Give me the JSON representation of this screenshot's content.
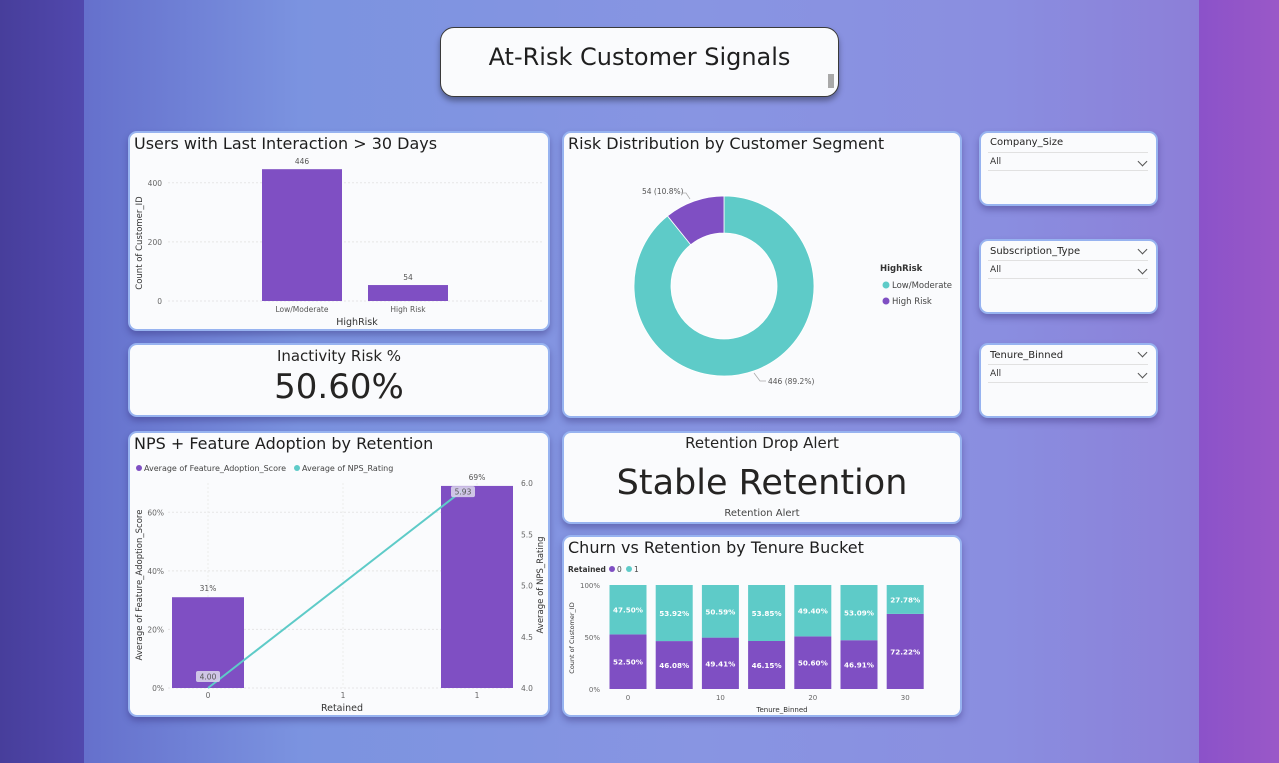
{
  "page": {
    "title": "At-Risk Customer Signals"
  },
  "colors": {
    "purple": "#7f4fc3",
    "teal": "#5ecbc8",
    "card_border": "#97b3f0"
  },
  "users_chart": {
    "title": "Users with Last Interaction > 30 Days",
    "ylabel": "Count of Customer_ID",
    "xlabel": "HighRisk",
    "yticks": [
      "0",
      "200",
      "400"
    ]
  },
  "inactivity": {
    "label": "Inactivity Risk %",
    "value": "50.60%"
  },
  "risk_dist": {
    "title": "Risk Distribution by Customer Segment",
    "legend_title": "HighRisk",
    "label_high": "54 (10.8%)",
    "label_low": "446 (89.2%)"
  },
  "retention_alert": {
    "title": "Retention Drop Alert",
    "value": "Stable Retention",
    "caption": "Retention Alert"
  },
  "nps_chart": {
    "title": "NPS + Feature Adoption by Retention",
    "legend": [
      "Average of Feature_Adoption_Score",
      "Average of NPS_Rating"
    ],
    "ylabel_left": "Average of Feature_Adoption_Score",
    "ylabel_right": "Average of NPS_Rating",
    "xlabel": "Retained",
    "left_ticks": [
      "0%",
      "20%",
      "40%",
      "60%"
    ],
    "right_ticks": [
      "4.0",
      "4.5",
      "5.0",
      "5.5",
      "6.0"
    ],
    "x_ticks": [
      "0",
      "1",
      "1"
    ]
  },
  "churn_chart": {
    "title": "Churn vs Retention by Tenure Bucket",
    "legend_title": "Retained",
    "legend": [
      "0",
      "1"
    ],
    "ylabel": "Count of Customer_ID",
    "xlabel": "Tenure_Binned",
    "yticks": [
      "0%",
      "50%",
      "100%"
    ],
    "xticks": [
      "0",
      "10",
      "20",
      "30",
      "40"
    ]
  },
  "slicers": [
    {
      "label": "Company_Size",
      "value": "All"
    },
    {
      "label": "Subscription_Type",
      "value": "All"
    },
    {
      "label": "Tenure_Binned",
      "value": "All"
    }
  ],
  "chart_data": [
    {
      "type": "bar",
      "title": "Users with Last Interaction > 30 Days",
      "categories": [
        "Low/Moderate",
        "High Risk"
      ],
      "values": [
        446,
        54
      ],
      "xlabel": "HighRisk",
      "ylabel": "Count of Customer_ID",
      "ylim": [
        0,
        450
      ]
    },
    {
      "type": "pie",
      "title": "Risk Distribution by Customer Segment",
      "categories": [
        "Low/Moderate",
        "High Risk"
      ],
      "values": [
        446,
        54
      ],
      "percentages": [
        89.2,
        10.8
      ],
      "legend_title": "HighRisk",
      "legend": "right"
    },
    {
      "type": "bar",
      "title": "NPS + Feature Adoption by Retention",
      "categories": [
        "0",
        "1"
      ],
      "series": [
        {
          "name": "Average of Feature_Adoption_Score",
          "values": [
            31,
            69
          ],
          "labels": [
            "31%",
            "69%"
          ]
        },
        {
          "name": "Average of NPS_Rating",
          "values": [
            4.0,
            5.93
          ],
          "labels": [
            "4.00",
            "5.93"
          ]
        }
      ],
      "xlabel": "Retained",
      "ylabel": "Average of Feature_Adoption_Score",
      "y2label": "Average of NPS_Rating",
      "ylim": [
        0,
        70
      ],
      "y2lim": [
        4.0,
        6.0
      ]
    },
    {
      "type": "bar",
      "title": "Churn vs Retention by Tenure Bucket",
      "legend_title": "Retained",
      "x": [
        0,
        5,
        10,
        15,
        20,
        25,
        30,
        35
      ],
      "series": [
        {
          "name": "0",
          "values": [
            52.5,
            46.08,
            49.41,
            46.15,
            50.6,
            46.91,
            72.22
          ],
          "labels": [
            "52.50%",
            "46.08%",
            "49.41%",
            "46.15%",
            "50.60%",
            "46.91%",
            "72.22%"
          ]
        },
        {
          "name": "1",
          "values": [
            47.5,
            53.92,
            50.59,
            53.85,
            49.4,
            53.09,
            27.78
          ],
          "labels": [
            "47.50%",
            "53.92%",
            "50.59%",
            "53.85%",
            "49.40%",
            "53.09%",
            "27.78%"
          ]
        }
      ],
      "xlabel": "Tenure_Binned",
      "ylabel": "Count of Customer_ID",
      "ylim": [
        0,
        100
      ]
    }
  ]
}
